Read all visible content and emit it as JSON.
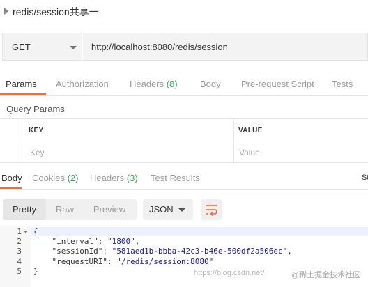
{
  "title": "redis/session共享一",
  "request": {
    "method": "GET",
    "url": "http://localhost:8080/redis/session"
  },
  "request_tabs": [
    {
      "label": "Params",
      "count": ""
    },
    {
      "label": "Authorization",
      "count": ""
    },
    {
      "label": "Headers",
      "count": "(8)"
    },
    {
      "label": "Body",
      "count": ""
    },
    {
      "label": "Pre-request Script",
      "count": ""
    },
    {
      "label": "Tests",
      "count": ""
    }
  ],
  "query_params": {
    "label": "Query Params",
    "key_header": "KEY",
    "value_header": "VALUE",
    "key_placeholder": "Key",
    "value_placeholder": "Value"
  },
  "response_tabs": [
    {
      "label": "Body",
      "count": ""
    },
    {
      "label": "Cookies",
      "count": "(2)"
    },
    {
      "label": "Headers",
      "count": "(3)"
    },
    {
      "label": "Test Results",
      "count": ""
    }
  ],
  "status_partial": "St",
  "format_buttons": [
    "Pretty",
    "Raw",
    "Preview"
  ],
  "format_select": "JSON",
  "code_lines": [
    {
      "n": "1",
      "parts": [
        {
          "t": "{",
          "c": "k"
        }
      ]
    },
    {
      "n": "2",
      "parts": [
        {
          "t": "    \"interval\"",
          "c": "k"
        },
        {
          "t": ": ",
          "c": "k"
        },
        {
          "t": "\"1800\"",
          "c": "s"
        },
        {
          "t": ",",
          "c": "k"
        }
      ]
    },
    {
      "n": "3",
      "parts": [
        {
          "t": "    \"sessionId\"",
          "c": "k"
        },
        {
          "t": ": ",
          "c": "k"
        },
        {
          "t": "\"581aed1b-bbba-42c3-b46e-500df2a506ec\"",
          "c": "s"
        },
        {
          "t": ",",
          "c": "k"
        }
      ]
    },
    {
      "n": "4",
      "parts": [
        {
          "t": "    \"requestURI\"",
          "c": "k"
        },
        {
          "t": ": ",
          "c": "k"
        },
        {
          "t": "\"/redis/session:8080\"",
          "c": "s"
        }
      ]
    },
    {
      "n": "5",
      "parts": [
        {
          "t": "}",
          "c": "k"
        }
      ]
    }
  ],
  "watermark": "https://blog.csdn.net/",
  "watermark_brand": "@稀土掘金技术社区",
  "colors": {
    "accent": "#f26b3a",
    "count_green": "#3aa55f",
    "string": "#1a1aa6"
  }
}
